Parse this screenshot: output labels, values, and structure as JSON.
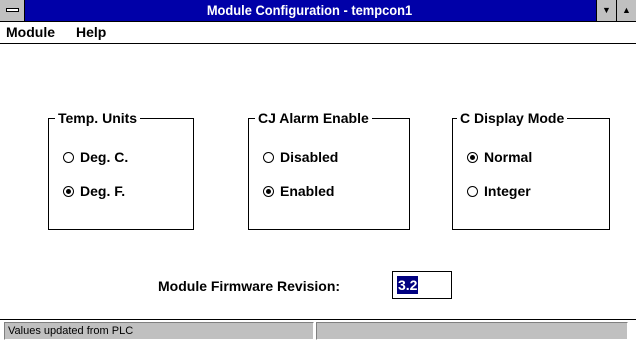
{
  "window": {
    "title": "Module Configuration - tempcon1"
  },
  "menu": {
    "module": "Module",
    "help": "Help"
  },
  "groups": {
    "temp_units": {
      "title": "Temp. Units",
      "options": [
        {
          "label": "Deg. C.",
          "selected": false
        },
        {
          "label": "Deg. F.",
          "selected": true
        }
      ]
    },
    "cj_alarm": {
      "title": "CJ Alarm Enable",
      "options": [
        {
          "label": "Disabled",
          "selected": false
        },
        {
          "label": "Enabled",
          "selected": true
        }
      ]
    },
    "c_display": {
      "title": "C Display Mode",
      "options": [
        {
          "label": "Normal",
          "selected": true
        },
        {
          "label": "Integer",
          "selected": false
        }
      ]
    }
  },
  "firmware": {
    "label": "Module Firmware Revision:",
    "value": "3.2"
  },
  "status": {
    "text": "Values updated from PLC"
  }
}
